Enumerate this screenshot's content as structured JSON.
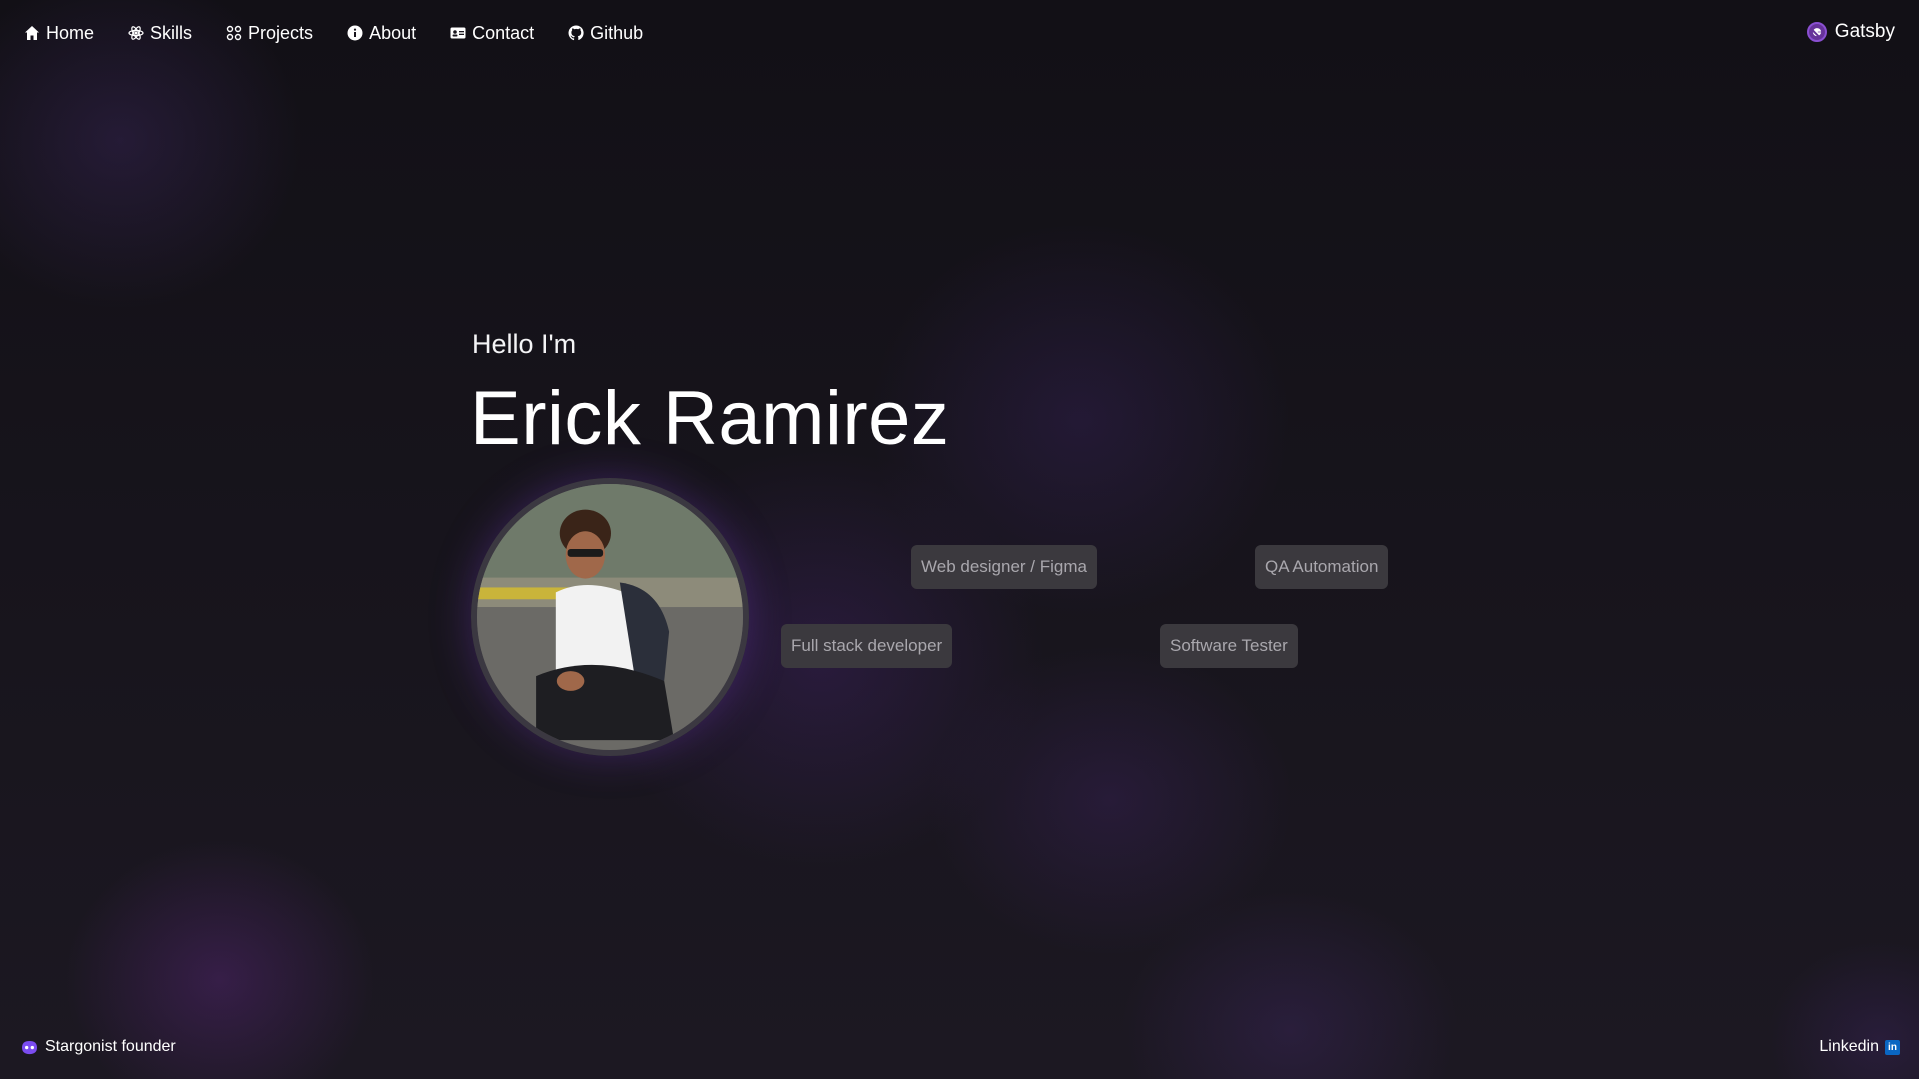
{
  "nav": {
    "items": [
      {
        "label": "Home",
        "icon": "home-icon"
      },
      {
        "label": "Skills",
        "icon": "atom-icon"
      },
      {
        "label": "Projects",
        "icon": "grid-icon"
      },
      {
        "label": "About",
        "icon": "info-icon"
      },
      {
        "label": "Contact",
        "icon": "id-card-icon"
      },
      {
        "label": "Github",
        "icon": "github-icon"
      }
    ],
    "brand": {
      "label": "Gatsby",
      "icon": "gatsby-icon",
      "color": "#663399"
    }
  },
  "hero": {
    "greeting": "Hello I'm",
    "name": "Erick Ramirez",
    "photo_icon": "profile-photo"
  },
  "roles": [
    "Web designer / Figma",
    "QA Automation",
    "Full stack developer",
    "Software Tester"
  ],
  "footer": {
    "left_label": "Stargonist founder",
    "left_icon": "stargonist-icon",
    "right_label": "Linkedin",
    "right_icon": "linkedin-icon"
  },
  "colors": {
    "background": "#17141c",
    "accent": "#663399",
    "tag_bg": "#3b393e",
    "linkedin": "#0a66c2"
  }
}
